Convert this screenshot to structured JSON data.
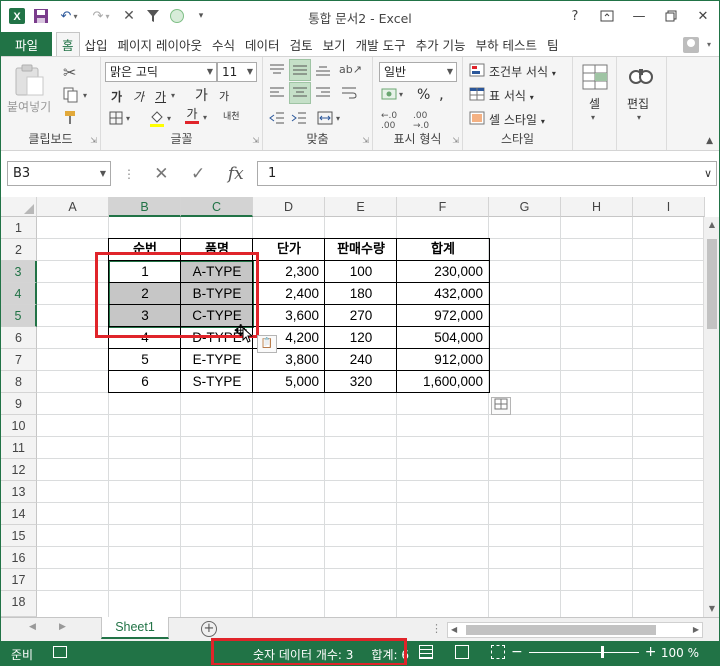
{
  "app": {
    "title": "통합 문서2 - Excel"
  },
  "qat": {
    "save_icon": "save-icon",
    "undo_icon": "undo-icon",
    "redo_icon": "redo-icon"
  },
  "ribbon_tabs": [
    "파일",
    "홈",
    "삽입",
    "페이지 레이아웃",
    "수식",
    "데이터",
    "검토",
    "보기",
    "개발 도구",
    "추가 기능",
    "부하 테스트",
    "팀"
  ],
  "ribbon": {
    "clipboard": {
      "paste": "붙여넣기",
      "label": "클립보드"
    },
    "font": {
      "name": "맑은 고딕",
      "size": "11",
      "label": "글꼴",
      "bold": "가",
      "italic": "가",
      "underline": "가",
      "grow": "가",
      "shrink": "가",
      "color_glyph": "가",
      "phonetic": "내천"
    },
    "alignment": {
      "label": "맞춤"
    },
    "number": {
      "format": "일반",
      "percent": "%",
      "label": "표시 형식"
    },
    "styles": {
      "conditional": "조건부 서식",
      "table": "표 서식",
      "cell": "셀 스타일",
      "label": "스타일"
    },
    "cells": {
      "label": "셀"
    },
    "editing": {
      "label": "편집"
    }
  },
  "formula_bar": {
    "name_box": "B3",
    "cancel": "✕",
    "enter": "✓",
    "fx": "fx",
    "value": "1"
  },
  "columns": [
    "A",
    "B",
    "C",
    "D",
    "E",
    "F",
    "G",
    "H",
    "I"
  ],
  "rows": [
    "1",
    "2",
    "3",
    "4",
    "5",
    "6",
    "7",
    "8",
    "9",
    "10",
    "11",
    "12",
    "13",
    "14",
    "15",
    "16",
    "17",
    "18"
  ],
  "table": {
    "headers": [
      "순번",
      "품명",
      "단가",
      "판매수량",
      "합계"
    ],
    "rows": [
      [
        "1",
        "A-TYPE",
        "2,300",
        "100",
        "230,000"
      ],
      [
        "2",
        "B-TYPE",
        "2,400",
        "180",
        "432,000"
      ],
      [
        "3",
        "C-TYPE",
        "3,600",
        "270",
        "972,000"
      ],
      [
        "4",
        "D-TYPE",
        "4,200",
        "120",
        "504,000"
      ],
      [
        "5",
        "E-TYPE",
        "3,800",
        "240",
        "912,000"
      ],
      [
        "6",
        "S-TYPE",
        "5,000",
        "320",
        "1,600,000"
      ]
    ]
  },
  "sheet_tabs": [
    "Sheet1"
  ],
  "status": {
    "ready": "준비",
    "count": "숫자 데이터 개수: 3",
    "sum": "합계: 6",
    "zoom": "100 %",
    "zoom_out": "−",
    "zoom_in": "+"
  },
  "colors": {
    "accent": "#217346",
    "highlight": "#e0242a"
  }
}
